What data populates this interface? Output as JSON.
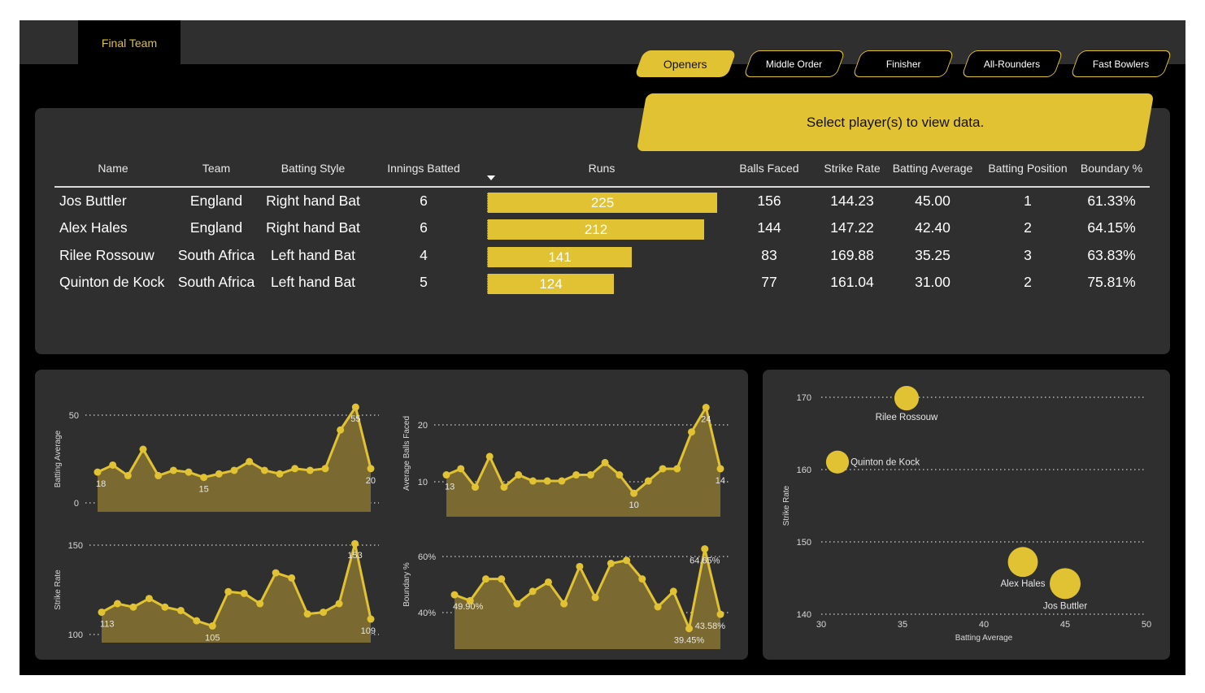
{
  "tabs": {
    "final_team": "Final Team"
  },
  "nav": [
    "Openers",
    "Middle Order",
    "Finisher",
    "All-Rounders",
    "Fast Bowlers"
  ],
  "banner": "Select player(s) to view data.",
  "colors": {
    "accent": "#e1c233",
    "panel": "#2f2f2f",
    "background": "#000000"
  },
  "table": {
    "columns": [
      "Name",
      "Team",
      "Batting Style",
      "Innings Batted",
      "Runs",
      "Balls Faced",
      "Strike Rate",
      "Batting Average",
      "Batting Position",
      "Boundary %"
    ],
    "sorted_column": "Runs",
    "rows": [
      {
        "name": "Jos Buttler",
        "team": "England",
        "style": "Right hand Bat",
        "innings": "6",
        "runs": "225",
        "balls": "156",
        "sr": "144.23",
        "avg": "45.00",
        "pos": "1",
        "boundary": "61.33%"
      },
      {
        "name": "Alex Hales",
        "team": "England",
        "style": "Right hand Bat",
        "innings": "6",
        "runs": "212",
        "balls": "144",
        "sr": "147.22",
        "avg": "42.40",
        "pos": "2",
        "boundary": "64.15%"
      },
      {
        "name": "Rilee Rossouw",
        "team": "South Africa",
        "style": "Left hand Bat",
        "innings": "4",
        "runs": "141",
        "balls": "83",
        "sr": "169.88",
        "avg": "35.25",
        "pos": "3",
        "boundary": "63.83%"
      },
      {
        "name": "Quinton de Kock",
        "team": "South Africa",
        "style": "Left hand Bat",
        "innings": "5",
        "runs": "124",
        "balls": "77",
        "sr": "161.04",
        "avg": "31.00",
        "pos": "2",
        "boundary": "75.81%"
      }
    ],
    "runs_max": 225
  },
  "chart_data": [
    {
      "type": "area",
      "ylabel": "Batting Average",
      "yticks": [
        "0",
        "50"
      ],
      "ylim": [
        0,
        56
      ],
      "values": [
        18,
        22,
        16,
        31,
        16,
        19,
        18,
        15,
        17,
        19,
        24,
        19,
        17,
        20,
        19,
        20,
        42,
        55,
        20
      ],
      "labels": [
        {
          "index": 0,
          "text": "18"
        },
        {
          "index": 7,
          "text": "15"
        },
        {
          "index": 17,
          "text": "55"
        },
        {
          "index": 18,
          "text": "20"
        }
      ]
    },
    {
      "type": "area",
      "ylabel": "Average Balls Faced",
      "yticks": [
        "10",
        "20"
      ],
      "ylim": [
        7.5,
        25
      ],
      "values": [
        13,
        14,
        11,
        16,
        11,
        13,
        12,
        12,
        12,
        13,
        13,
        15,
        13,
        10,
        12,
        14,
        14,
        20,
        24,
        14
      ],
      "labels": [
        {
          "index": 0,
          "text": "13"
        },
        {
          "index": 13,
          "text": "10"
        },
        {
          "index": 18,
          "text": "24"
        },
        {
          "index": 19,
          "text": "14"
        }
      ]
    },
    {
      "type": "area",
      "ylabel": "Strike Rate",
      "yticks": [
        "100",
        "150"
      ],
      "ylim": [
        100,
        155
      ],
      "values": [
        113,
        118,
        116,
        121,
        116,
        114,
        108,
        105,
        125,
        124,
        118,
        136,
        133,
        112,
        113,
        118,
        153,
        109
      ],
      "labels": [
        {
          "index": 0,
          "text": "113"
        },
        {
          "index": 7,
          "text": "105"
        },
        {
          "index": 16,
          "text": "153"
        },
        {
          "index": 17,
          "text": "109"
        }
      ]
    },
    {
      "type": "area",
      "ylabel": "Boundary %",
      "yticks": [
        "40%",
        "60%"
      ],
      "ylim": [
        0.35,
        0.68
      ],
      "values": [
        0.499,
        0.48,
        0.55,
        0.55,
        0.47,
        0.51,
        0.54,
        0.47,
        0.59,
        0.49,
        0.6,
        0.61,
        0.55,
        0.46,
        0.51,
        0.39,
        0.647,
        0.436
      ],
      "labels": [
        {
          "index": 0,
          "text": "49.90%"
        },
        {
          "index": 15,
          "text": "39.45%"
        },
        {
          "index": 16,
          "text": "64.65%"
        },
        {
          "index": 17,
          "text": "43.58%"
        }
      ]
    },
    {
      "type": "scatter",
      "xlabel": "Batting Average",
      "ylabel": "Strike Rate",
      "xlim": [
        30,
        50
      ],
      "ylim": [
        140,
        170
      ],
      "xticks": [
        "30",
        "35",
        "40",
        "45",
        "50"
      ],
      "yticks": [
        "140",
        "150",
        "160",
        "170"
      ],
      "points": [
        {
          "name": "Rilee Rossouw",
          "x": 35.25,
          "y": 169.88,
          "size": 141
        },
        {
          "name": "Quinton de Kock",
          "x": 31.0,
          "y": 161.04,
          "size": 124
        },
        {
          "name": "Alex Hales",
          "x": 42.4,
          "y": 147.22,
          "size": 212
        },
        {
          "name": "Jos Buttler",
          "x": 45.0,
          "y": 144.23,
          "size": 225
        }
      ]
    }
  ]
}
